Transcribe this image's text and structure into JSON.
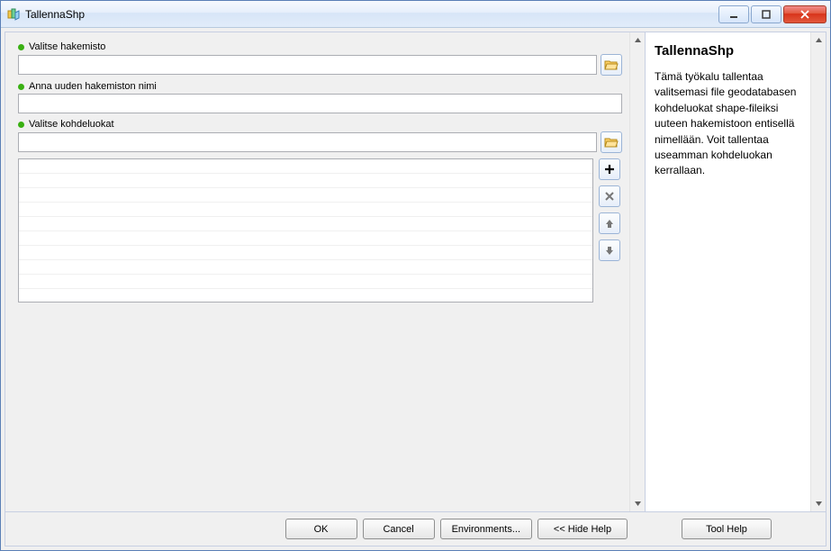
{
  "window": {
    "title": "TallennaShp"
  },
  "params": {
    "p1": {
      "label": "Valitse hakemisto",
      "value": ""
    },
    "p2": {
      "label": "Anna uuden hakemiston nimi",
      "value": ""
    },
    "p3": {
      "label": "Valitse kohdeluokat",
      "value": ""
    }
  },
  "help": {
    "title": "TallennaShp",
    "body": "Tämä työkalu tallentaa valitsemasi file geodatabasen kohdeluokat shape-fileiksi uuteen hakemistoon entisellä nimellään. Voit tallentaa useamman kohdeluokan kerrallaan."
  },
  "buttons": {
    "ok": "OK",
    "cancel": "Cancel",
    "env": "Environments...",
    "hidehelp": "<< Hide Help",
    "toolhelp": "Tool Help"
  }
}
